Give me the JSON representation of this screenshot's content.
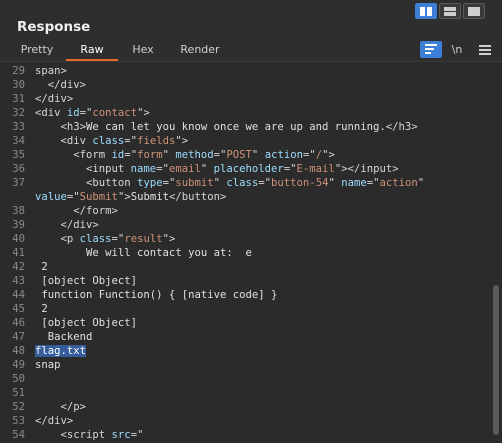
{
  "panel": {
    "title": "Response",
    "view_modes": [
      "split-horizontal",
      "split-vertical",
      "single-view"
    ]
  },
  "tabs": [
    {
      "label": "Pretty",
      "active": false
    },
    {
      "label": "Raw",
      "active": true
    },
    {
      "label": "Hex",
      "active": false
    },
    {
      "label": "Render",
      "active": false
    }
  ],
  "toolbar": {
    "wrap_icon": "word-wrap-icon",
    "newline_label": "\\n",
    "menu_icon": "hamburger-menu-icon"
  },
  "colors": {
    "accent": "#e8672c",
    "selection": "#365d9b",
    "active_toggle": "#3d7fd6",
    "tag": "#d6d6d6",
    "attribute": "#9cdcfe",
    "value": "#ce9178"
  },
  "editor": {
    "lines": [
      {
        "n": "29",
        "segs": [
          {
            "c": "t",
            "s": "span>"
          }
        ]
      },
      {
        "n": "30",
        "segs": [
          {
            "c": "t",
            "s": "  </div>"
          }
        ]
      },
      {
        "n": "31",
        "segs": [
          {
            "c": "t",
            "s": "</div>"
          }
        ]
      },
      {
        "n": "32",
        "segs": [
          {
            "c": "t",
            "s": "<div "
          },
          {
            "c": "a",
            "s": "id"
          },
          {
            "c": "t",
            "s": "=\""
          },
          {
            "c": "v",
            "s": "contact"
          },
          {
            "c": "t",
            "s": "\">"
          }
        ]
      },
      {
        "n": "33",
        "segs": [
          {
            "c": "t",
            "s": "    <h3>"
          },
          {
            "c": "tx",
            "s": "We can let you know once we are up and running."
          },
          {
            "c": "t",
            "s": "</h3>"
          }
        ]
      },
      {
        "n": "34",
        "segs": [
          {
            "c": "t",
            "s": "    <div "
          },
          {
            "c": "a",
            "s": "class"
          },
          {
            "c": "t",
            "s": "=\""
          },
          {
            "c": "v",
            "s": "fields"
          },
          {
            "c": "t",
            "s": "\">"
          }
        ]
      },
      {
        "n": "35",
        "segs": [
          {
            "c": "t",
            "s": "      <form "
          },
          {
            "c": "a",
            "s": "id"
          },
          {
            "c": "t",
            "s": "=\""
          },
          {
            "c": "v",
            "s": "form"
          },
          {
            "c": "t",
            "s": "\" "
          },
          {
            "c": "a",
            "s": "method"
          },
          {
            "c": "t",
            "s": "=\""
          },
          {
            "c": "v",
            "s": "POST"
          },
          {
            "c": "t",
            "s": "\" "
          },
          {
            "c": "a",
            "s": "action"
          },
          {
            "c": "t",
            "s": "=\""
          },
          {
            "c": "v",
            "s": "/"
          },
          {
            "c": "t",
            "s": "\">"
          }
        ]
      },
      {
        "n": "36",
        "segs": [
          {
            "c": "t",
            "s": "        <input "
          },
          {
            "c": "a",
            "s": "name"
          },
          {
            "c": "t",
            "s": "=\""
          },
          {
            "c": "v",
            "s": "email"
          },
          {
            "c": "t",
            "s": "\" "
          },
          {
            "c": "a",
            "s": "placeholder"
          },
          {
            "c": "t",
            "s": "=\""
          },
          {
            "c": "v",
            "s": "E-mail"
          },
          {
            "c": "t",
            "s": "\"></input>"
          }
        ]
      },
      {
        "n": "37",
        "segs": [
          {
            "c": "t",
            "s": "        <button "
          },
          {
            "c": "a",
            "s": "type"
          },
          {
            "c": "t",
            "s": "=\""
          },
          {
            "c": "v",
            "s": "submit"
          },
          {
            "c": "t",
            "s": "\" "
          },
          {
            "c": "a",
            "s": "class"
          },
          {
            "c": "t",
            "s": "=\""
          },
          {
            "c": "v",
            "s": "button-54"
          },
          {
            "c": "t",
            "s": "\" "
          },
          {
            "c": "a",
            "s": "name"
          },
          {
            "c": "t",
            "s": "=\""
          },
          {
            "c": "v",
            "s": "action"
          },
          {
            "c": "t",
            "s": "\""
          }
        ]
      },
      {
        "n": "",
        "segs": [
          {
            "c": "a",
            "s": "value"
          },
          {
            "c": "t",
            "s": "=\""
          },
          {
            "c": "v",
            "s": "Submit"
          },
          {
            "c": "t",
            "s": "\">"
          },
          {
            "c": "tx",
            "s": "Submit"
          },
          {
            "c": "t",
            "s": "</button>"
          }
        ]
      },
      {
        "n": "38",
        "segs": [
          {
            "c": "t",
            "s": "      </form>"
          }
        ]
      },
      {
        "n": "39",
        "segs": [
          {
            "c": "t",
            "s": "    </div>"
          }
        ]
      },
      {
        "n": "40",
        "segs": [
          {
            "c": "t",
            "s": "    <p "
          },
          {
            "c": "a",
            "s": "class"
          },
          {
            "c": "t",
            "s": "=\""
          },
          {
            "c": "v",
            "s": "result"
          },
          {
            "c": "t",
            "s": "\">"
          }
        ]
      },
      {
        "n": "41",
        "segs": [
          {
            "c": "tx",
            "s": "        We will contact you at:  e"
          }
        ]
      },
      {
        "n": "42",
        "segs": [
          {
            "c": "tx",
            "s": " 2"
          }
        ]
      },
      {
        "n": "43",
        "segs": [
          {
            "c": "tx",
            "s": " [object Object]"
          }
        ]
      },
      {
        "n": "44",
        "segs": [
          {
            "c": "tx",
            "s": " function Function() { [native code] }"
          }
        ]
      },
      {
        "n": "45",
        "segs": [
          {
            "c": "tx",
            "s": " 2"
          }
        ]
      },
      {
        "n": "46",
        "segs": [
          {
            "c": "tx",
            "s": " [object Object]"
          }
        ]
      },
      {
        "n": "47",
        "segs": [
          {
            "c": "tx",
            "s": "  Backend"
          }
        ]
      },
      {
        "n": "48",
        "segs": [
          {
            "c": "sel",
            "s": "flag.txt"
          }
        ]
      },
      {
        "n": "49",
        "segs": [
          {
            "c": "tx",
            "s": "snap"
          }
        ]
      },
      {
        "n": "50",
        "segs": [
          {
            "c": "tx",
            "s": ""
          }
        ]
      },
      {
        "n": "51",
        "segs": [
          {
            "c": "tx",
            "s": ""
          }
        ]
      },
      {
        "n": "52",
        "segs": [
          {
            "c": "t",
            "s": "    </p>"
          }
        ]
      },
      {
        "n": "53",
        "segs": [
          {
            "c": "t",
            "s": "</div>"
          }
        ]
      },
      {
        "n": "54",
        "segs": [
          {
            "c": "t",
            "s": "    <script "
          },
          {
            "c": "a",
            "s": "src"
          },
          {
            "c": "t",
            "s": "=\""
          }
        ]
      }
    ]
  }
}
